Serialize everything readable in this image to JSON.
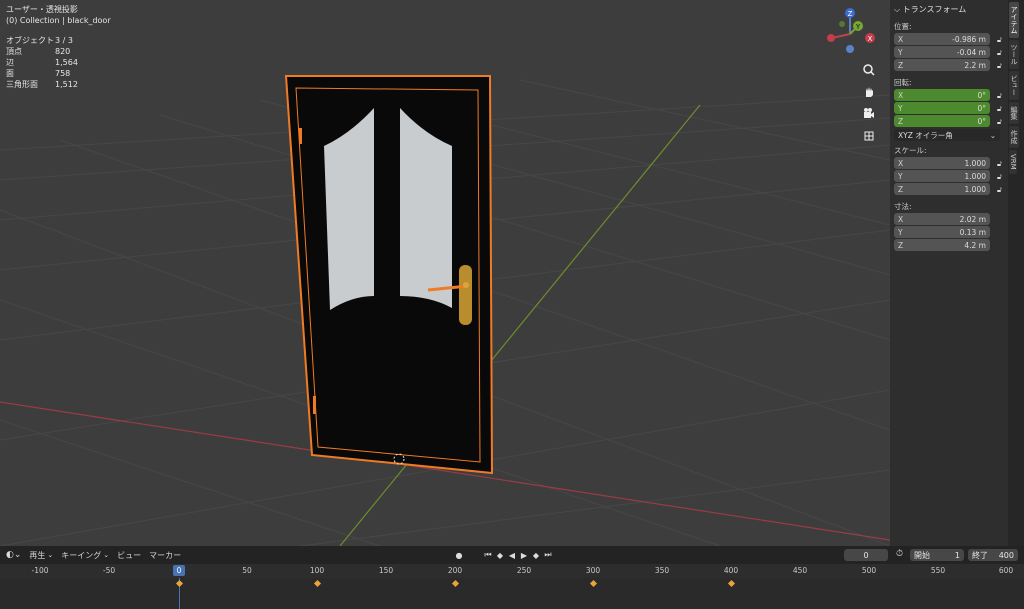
{
  "viewport": {
    "view_name": "ユーザー・透視投影",
    "collection": "(0) Collection | black_door",
    "stats": [
      {
        "label": "オブジェクト",
        "value": "3 / 3"
      },
      {
        "label": "頂点",
        "value": "820"
      },
      {
        "label": "辺",
        "value": "1,564"
      },
      {
        "label": "面",
        "value": "758"
      },
      {
        "label": "三角形面",
        "value": "1,512"
      }
    ],
    "gizmo": {
      "x": "X",
      "y": "Y",
      "z": "Z"
    },
    "tools": [
      "zoom-icon",
      "hand-icon",
      "camera-icon",
      "grid-icon"
    ]
  },
  "npanel": {
    "title": "トランスフォーム",
    "location_label": "位置:",
    "location": [
      {
        "axis": "X",
        "value": "-0.986 m"
      },
      {
        "axis": "Y",
        "value": "-0.04 m"
      },
      {
        "axis": "Z",
        "value": "2.2 m"
      }
    ],
    "rotation_label": "回転:",
    "rotation": [
      {
        "axis": "X",
        "value": "0°"
      },
      {
        "axis": "Y",
        "value": "0°"
      },
      {
        "axis": "Z",
        "value": "0°"
      }
    ],
    "rotation_mode": "XYZ オイラー角",
    "scale_label": "スケール:",
    "scale": [
      {
        "axis": "X",
        "value": "1.000"
      },
      {
        "axis": "Y",
        "value": "1.000"
      },
      {
        "axis": "Z",
        "value": "1.000"
      }
    ],
    "dims_label": "寸法:",
    "dims": [
      {
        "axis": "X",
        "value": "2.02 m"
      },
      {
        "axis": "Y",
        "value": "0.13 m"
      },
      {
        "axis": "Z",
        "value": "4.2 m"
      }
    ],
    "rotation_color": "#4d8a2f"
  },
  "tabs": [
    "アイテム",
    "ツール",
    "ビュー",
    "編集",
    "作成",
    "VRM"
  ],
  "timeline": {
    "menus": [
      "再生",
      "キーイング",
      "ビュー",
      "マーカー"
    ],
    "current_frame": "0",
    "start_label": "開始",
    "start_value": "1",
    "end_label": "終了",
    "end_value": "400",
    "ruler": [
      "-100",
      "-50",
      "0",
      "50",
      "100",
      "150",
      "200",
      "250",
      "300",
      "350",
      "400",
      "450",
      "500",
      "550",
      "600"
    ],
    "cursor": "0",
    "accent": "#4772b3"
  }
}
